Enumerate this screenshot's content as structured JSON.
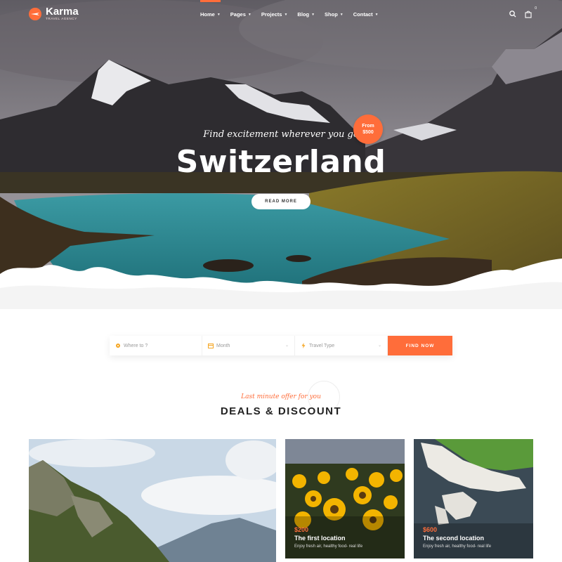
{
  "brand": {
    "name": "Karma",
    "tagline": "TRAVEL AGENCY"
  },
  "nav": {
    "items": [
      {
        "label": "Home"
      },
      {
        "label": "Pages"
      },
      {
        "label": "Projects"
      },
      {
        "label": "Blog"
      },
      {
        "label": "Shop"
      },
      {
        "label": "Contact"
      }
    ],
    "cart_count": "0"
  },
  "hero": {
    "subtitle": "Find excitement wherever you go",
    "title": "Switzerland",
    "badge_from": "From",
    "badge_price": "$500",
    "button": "READ MORE"
  },
  "search": {
    "where": "Where to ?",
    "month": "Month",
    "travel_type": "Travel Type",
    "button": "FIND NOW"
  },
  "deals": {
    "subtitle": "Last minute offer for you",
    "title": "DEALS & DISCOUNT",
    "cards": [
      {
        "price": "",
        "name": "",
        "desc": ""
      },
      {
        "price": "$200",
        "name": "The first location",
        "desc": "Enjoy fresh air, healthy food- real life"
      },
      {
        "price": "$600",
        "name": "The second location",
        "desc": "Enjoy fresh air, healthy food- real life"
      }
    ]
  },
  "colors": {
    "accent": "#ff6d3a"
  }
}
